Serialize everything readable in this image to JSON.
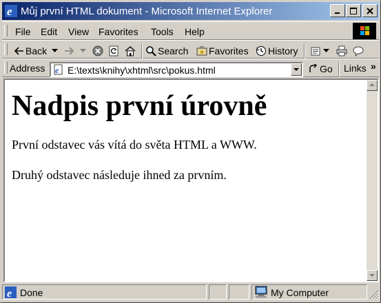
{
  "window": {
    "title": "Můj první HTML dokument - Microsoft Internet Explorer"
  },
  "menubar": {
    "items": [
      "File",
      "Edit",
      "View",
      "Favorites",
      "Tools",
      "Help"
    ]
  },
  "toolbar": {
    "back_label": "Back",
    "search_label": "Search",
    "favorites_label": "Favorites",
    "history_label": "History"
  },
  "addressbar": {
    "label": "Address",
    "value": "E:\\texts\\knihy\\xhtml\\src\\pokus.html",
    "go_label": "Go",
    "links_label": "Links",
    "more_glyph": "»"
  },
  "page": {
    "heading": "Nadpis první úrovně",
    "paragraphs": [
      "První odstavec vás vítá do světa HTML a WWW.",
      "Druhý odstavec následuje ihned za prvním."
    ]
  },
  "statusbar": {
    "status_text": "Done",
    "zone_text": "My Computer"
  },
  "colors": {
    "titlebar_start": "#0a246a",
    "titlebar_end": "#a6caf0",
    "chrome": "#d4d0c8"
  }
}
